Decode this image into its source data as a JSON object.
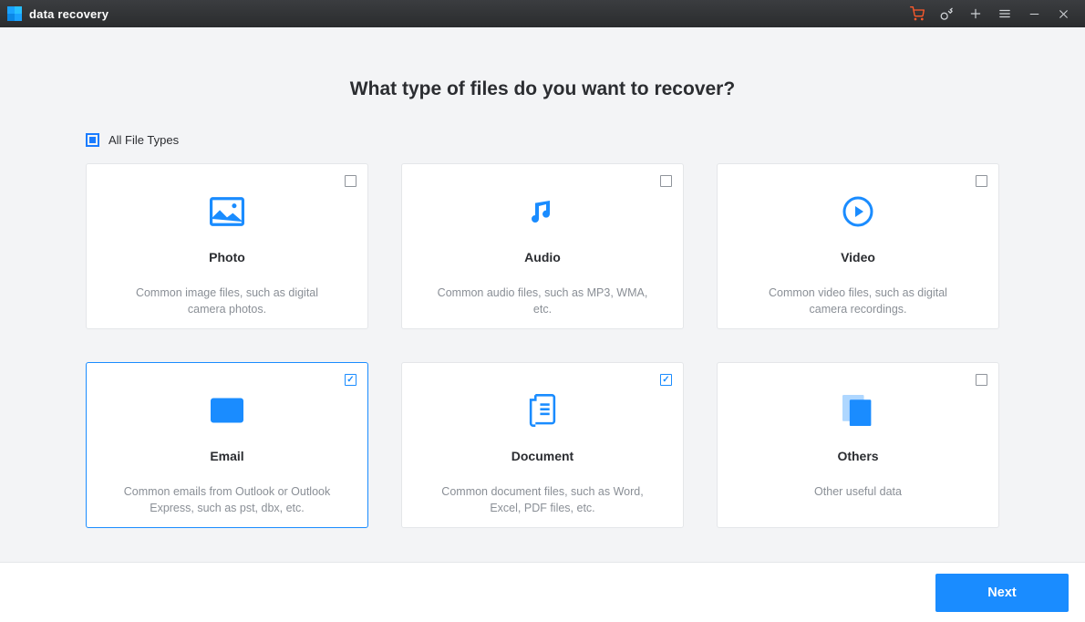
{
  "app_title": "data recovery",
  "heading": "What type of files do you want to recover?",
  "all_types_label": "All File Types",
  "all_types_state": "partial",
  "cards": [
    {
      "id": "photo",
      "title": "Photo",
      "desc": "Common image files, such as digital camera photos.",
      "checked": false
    },
    {
      "id": "audio",
      "title": "Audio",
      "desc": "Common audio files, such as MP3, WMA, etc.",
      "checked": false
    },
    {
      "id": "video",
      "title": "Video",
      "desc": "Common video files, such as digital camera recordings.",
      "checked": false
    },
    {
      "id": "email",
      "title": "Email",
      "desc": "Common emails from Outlook or Outlook Express, such as pst, dbx, etc.",
      "checked": true,
      "selected": true
    },
    {
      "id": "document",
      "title": "Document",
      "desc": "Common document files, such as Word, Excel, PDF files, etc.",
      "checked": true
    },
    {
      "id": "others",
      "title": "Others",
      "desc": "Other useful data",
      "checked": false
    }
  ],
  "footer": {
    "next_label": "Next"
  },
  "colors": {
    "accent": "#1a8cff",
    "cart_icon": "#ff5a2b"
  }
}
